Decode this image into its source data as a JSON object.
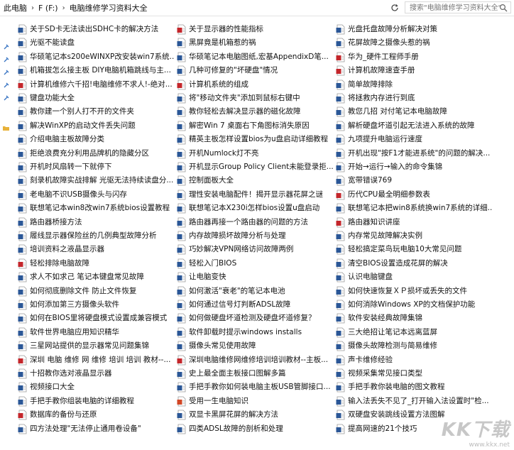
{
  "address": {
    "crumbs": [
      "此电脑",
      "F (F:)",
      "电脑维修学习资料大全"
    ],
    "search_placeholder": "搜索\"电脑维修学习资料大全\""
  },
  "columns": [
    {
      "items": [
        {
          "label": "关于SD卡无法读出SDHC卡的解决方法",
          "icon": "word"
        },
        {
          "label": "光驱不能读盘",
          "icon": "word"
        },
        {
          "label": "华硕笔记本s200eWINXP改安装win7系统...",
          "icon": "word"
        },
        {
          "label": "机箱拔怎么接主板 DIY电脑机箱跳线与主...",
          "icon": "word"
        },
        {
          "label": "计算机维修六千招!电脑维修不求人!-绝对...",
          "icon": "pdf"
        },
        {
          "label": "键盘功能大全",
          "icon": "word"
        },
        {
          "label": "教你建一个别人打不开的文件夹",
          "icon": "word"
        },
        {
          "label": "解决WinXP的启动文件丢失问题",
          "icon": "word"
        },
        {
          "label": "介绍电脑主板故障分类",
          "icon": "word"
        },
        {
          "label": "拒绝浪费充分利用品牌机的隐藏分区",
          "icon": "word"
        },
        {
          "label": "开机时风扇转一下就停下",
          "icon": "word"
        },
        {
          "label": "刻录机故障实战排解 光驱无法持续读盘分...",
          "icon": "word"
        },
        {
          "label": "老电脑不识USB摄像头与闪存",
          "icon": "word"
        },
        {
          "label": "联想笔记本win8改win7系统bios设置教程",
          "icon": "word"
        },
        {
          "label": "路由器桥接方法",
          "icon": "word"
        },
        {
          "label": "履线显示器保险丝的几例典型故障分析",
          "icon": "word"
        },
        {
          "label": "培训资料之液晶显示器",
          "icon": "word"
        },
        {
          "label": "轻松排除电脑故障",
          "icon": "pdf"
        },
        {
          "label": "求人不如求己 笔记本键盘常见故障",
          "icon": "word"
        },
        {
          "label": "如何彻底删除文件 防止文件恢复",
          "icon": "word"
        },
        {
          "label": "如何添加第三方摄像头软件",
          "icon": "word"
        },
        {
          "label": "如何在BIOS里将硬盘模式设置成兼容模式",
          "icon": "word"
        },
        {
          "label": "软件世界电脑应用知识精华",
          "icon": "word"
        },
        {
          "label": "三星网站提供的显示器常见问题集锦",
          "icon": "word"
        },
        {
          "label": "深圳 电脑 维修 网 维修 培训 培训 教材--...",
          "icon": "pdf"
        },
        {
          "label": "十招教你选对液晶显示器",
          "icon": "word"
        },
        {
          "label": "视频接口大全",
          "icon": "word"
        },
        {
          "label": "手把手教你组装电脑的详细教程",
          "icon": "word"
        },
        {
          "label": "数据库的备份与还原",
          "icon": "pdf"
        },
        {
          "label": "四方法处理\"无法停止通用卷设备\"",
          "icon": "word"
        }
      ]
    },
    {
      "items": [
        {
          "label": "关于显示器的性能指标",
          "icon": "pdf"
        },
        {
          "label": "黑屏竟是机箱惹的祸",
          "icon": "word"
        },
        {
          "label": "华硕笔记本电脑图纸,宏基AppendixD笔...",
          "icon": "word"
        },
        {
          "label": "几种可修复的\"坏硬盘\"情况",
          "icon": "word"
        },
        {
          "label": "计算机系统的组成",
          "icon": "pdf"
        },
        {
          "label": "将\"移动文件夹\"添加到鼠标右键中",
          "icon": "word"
        },
        {
          "label": "教你轻松去解决显示器的磁化故障",
          "icon": "word"
        },
        {
          "label": "解密Win 7 桌面右下角图标消失原因",
          "icon": "word"
        },
        {
          "label": "精英主板怎样设置bios为u盘启动详细教程",
          "icon": "word"
        },
        {
          "label": "开机Numlock灯不亮",
          "icon": "word"
        },
        {
          "label": "开机显示Group Policy Client未能登录拒...",
          "icon": "word"
        },
        {
          "label": "控制面板大全",
          "icon": "word"
        },
        {
          "label": "理性安装电脑配件！揭开显示器花屏之谜",
          "icon": "word"
        },
        {
          "label": "联想笔记本X230i怎样bios设置u盘启动",
          "icon": "word"
        },
        {
          "label": "路由器再接一个路由器的问题的方法",
          "icon": "word"
        },
        {
          "label": "内存故障损坏故障分析与处理",
          "icon": "word"
        },
        {
          "label": "巧妙解决VPN网络访问故障两例",
          "icon": "word"
        },
        {
          "label": "轻松入门BIOS",
          "icon": "word"
        },
        {
          "label": "让电脑变快",
          "icon": "word"
        },
        {
          "label": "如何激活\"衰老\"的笔记本电池",
          "icon": "word"
        },
        {
          "label": "如何通过信号灯判断ADSL故障",
          "icon": "word"
        },
        {
          "label": "如何做硬盘坏道检测及硬盘坏道修复？",
          "icon": "word"
        },
        {
          "label": "软件卸载时提示windows installs",
          "icon": "word"
        },
        {
          "label": "摄像头常见使用故障",
          "icon": "word"
        },
        {
          "label": "深圳电脑维修网维修培训培训教材--主板...",
          "icon": "pdf"
        },
        {
          "label": "史上最全面主板接口图解多篇",
          "icon": "word"
        },
        {
          "label": "手把手教你如何装电脑主板USB管脚接口...",
          "icon": "word"
        },
        {
          "label": "受用一生电脑知识",
          "icon": "ppt"
        },
        {
          "label": "双显卡黑屏花屏的解决方法",
          "icon": "word"
        },
        {
          "label": "四类ADSL故障的剖析和处理",
          "icon": "word"
        }
      ]
    },
    {
      "items": [
        {
          "label": "光盘托盘故障分析解决对策",
          "icon": "word"
        },
        {
          "label": "花屏故障之摄像头惹的祸",
          "icon": "word"
        },
        {
          "label": "华为_硬件工程师手册",
          "icon": "pdf"
        },
        {
          "label": "计算机故障速查手册",
          "icon": "pdf"
        },
        {
          "label": "简单故障排除",
          "icon": "word"
        },
        {
          "label": "将拯救内存进行到底",
          "icon": "word"
        },
        {
          "label": "教您几招 对付笔记本电脑故障",
          "icon": "word"
        },
        {
          "label": "解析硬盘坏道引起无法进入系统的故障",
          "icon": "word"
        },
        {
          "label": "九项提升电脑运行速度",
          "icon": "word"
        },
        {
          "label": "开机出现\"按F1才能进系统\"的问题的解决...",
          "icon": "word"
        },
        {
          "label": "开始→运行→输入的命令集锦",
          "icon": "word"
        },
        {
          "label": "宽带错误769",
          "icon": "word"
        },
        {
          "label": "历代CPU最全明细参数表",
          "icon": "pdf"
        },
        {
          "label": "联想笔记本把win8系统换win7系统的详细...",
          "icon": "word"
        },
        {
          "label": "路由器知识讲座",
          "icon": "pdf"
        },
        {
          "label": "内存常见故障解决实例",
          "icon": "word"
        },
        {
          "label": "轻松搞定菜鸟玩电脑10大常见问题",
          "icon": "word"
        },
        {
          "label": "清空BIOS设置造成花屏的解决",
          "icon": "word"
        },
        {
          "label": "认识电脑键盘",
          "icon": "word"
        },
        {
          "label": "如何快速恢复ＸＰ损坏或丢失的文件",
          "icon": "word"
        },
        {
          "label": "如何消除Windows XP的文档保护功能",
          "icon": "word"
        },
        {
          "label": "软件安装经典故障集锦",
          "icon": "word"
        },
        {
          "label": "三大绝招让笔记本远离蓝屏",
          "icon": "word"
        },
        {
          "label": "摄像头故障检测与简易维修",
          "icon": "word"
        },
        {
          "label": "声卡维修经验",
          "icon": "word"
        },
        {
          "label": "视频采集常见接口类型",
          "icon": "word"
        },
        {
          "label": "手把手教你装电脑的图文教程",
          "icon": "word"
        },
        {
          "label": "输入法丢失不见了_打开输入法设置时\"检...",
          "icon": "word"
        },
        {
          "label": "双硬盘安装跳线设置方法图解",
          "icon": "word"
        },
        {
          "label": "提高网速的21个技巧",
          "icon": "word"
        }
      ]
    }
  ],
  "watermark": {
    "logo": "KK下载",
    "url": "www.kkx.net"
  },
  "colors": {
    "word": "#2b5797",
    "pdf": "#c4262b",
    "ppt": "#d24726",
    "folder": "#e8b23a"
  }
}
